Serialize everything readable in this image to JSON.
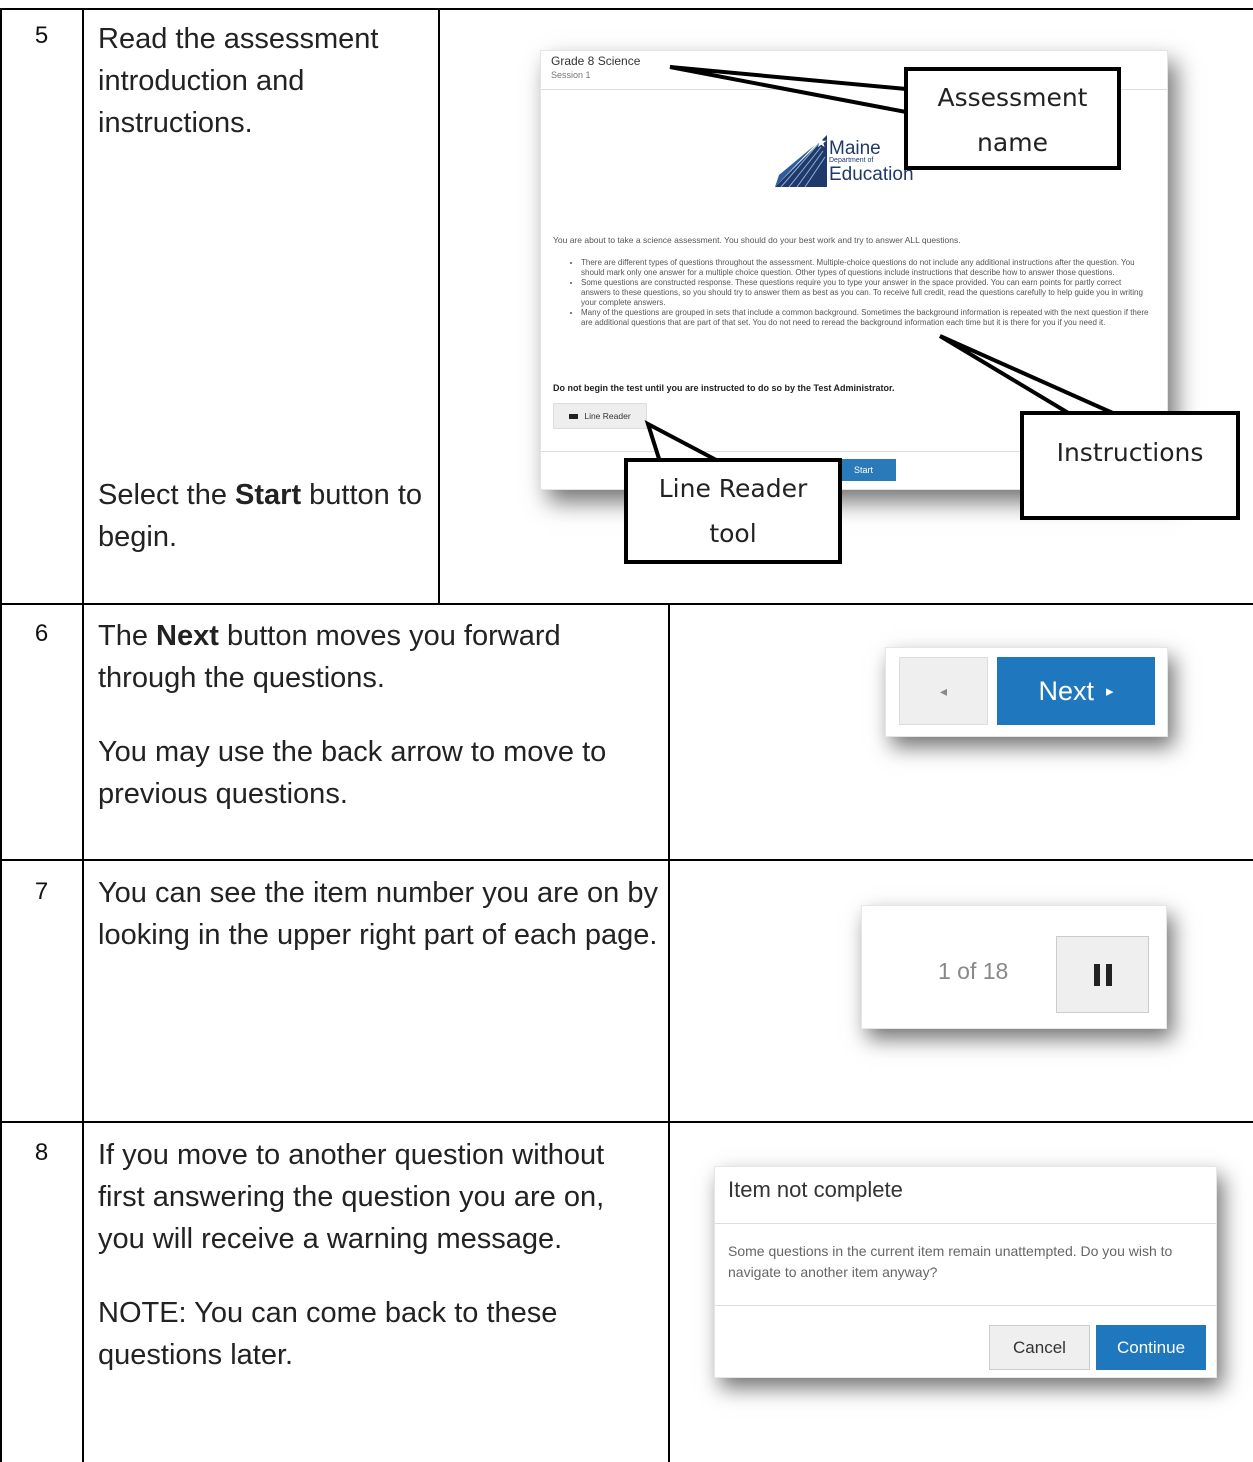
{
  "steps": [
    {
      "number": "5",
      "text": "Read the assessment introduction and instructions.",
      "text2_pre": "Select the ",
      "text2_bold": "Start",
      "text2_post": " button to begin."
    },
    {
      "number": "6",
      "text_pre": "The ",
      "text_bold": "Next",
      "text_post": " button moves you forward through the questions.",
      "text2": "You may use the back arrow to move to previous questions."
    },
    {
      "number": "7",
      "text": "You can see the item number you are on by looking in the upper right part of each page."
    },
    {
      "number": "8",
      "text": "If you move to another question without first answering the question you are on, you will receive a warning message.",
      "text2": "NOTE: You can come back to these questions later."
    }
  ],
  "screenshot5": {
    "title": "Grade 8 Science",
    "session": "Session 1",
    "logo": {
      "name": "Maine",
      "dept": "Department of",
      "edu": "Education"
    },
    "intro": "You are about to take a science assessment. You should do your best work and try to answer ALL questions.",
    "bullets": [
      "There are different types of questions throughout the assessment. Multiple-choice questions do not include any additional instructions after the question. You should mark only one answer for a multiple choice question. Other types of questions include instructions that describe how to answer those questions.",
      "Some questions are constructed response. These questions require you to type your answer in the space provided. You can earn points for partly correct answers to these questions, so you should try to answer them as best as you can. To receive full credit, read the questions carefully to help guide you in writing your complete answers.",
      "Many of the questions are grouped in sets that include a common background. Sometimes the background information is repeated with the next question if there are additional questions that are part of that set. You do not need to reread the background information each time but it is there for you if you need it."
    ],
    "bold_note": "Do not begin the test until you are instructed to do so by the Test Administrator.",
    "line_reader_label": "Line Reader",
    "start_label": "Start"
  },
  "callouts": {
    "assessment_name": [
      "Assessment",
      "name"
    ],
    "instructions": "Instructions",
    "line_reader": [
      "Line Reader",
      "tool"
    ]
  },
  "screenshot6": {
    "back_icon": "◂",
    "next_label": "Next",
    "next_icon": "▸"
  },
  "screenshot7": {
    "counter": "1 of 18"
  },
  "screenshot8": {
    "title": "Item not complete",
    "body": "Some questions in the current item remain unattempted. Do you wish to navigate to another item anyway?",
    "cancel_label": "Cancel",
    "continue_label": "Continue"
  }
}
